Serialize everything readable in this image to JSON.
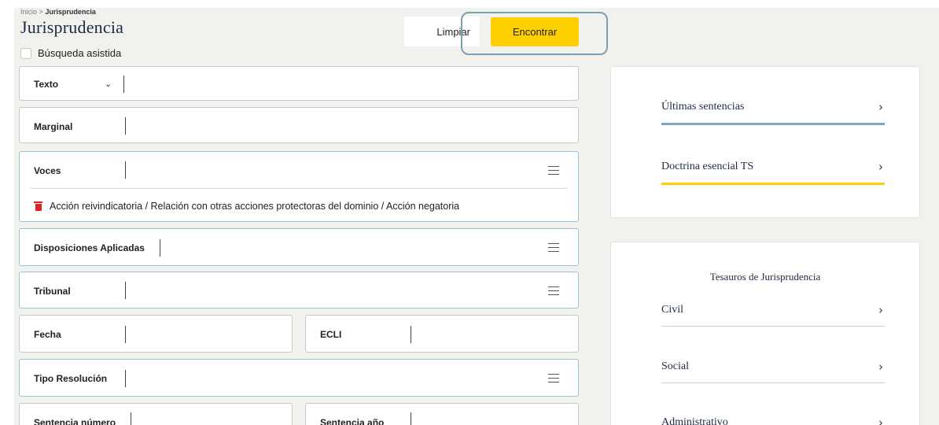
{
  "breadcrumb": {
    "home": "Inicio",
    "sep": ">",
    "current": "Jurisprudencia"
  },
  "page_title": "Jurisprudencia",
  "assisted_search_label": "Búsqueda asistida",
  "buttons": {
    "clear": "Limpiar",
    "find": "Encontrar"
  },
  "fields": {
    "texto": "Texto",
    "marginal": "Marginal",
    "voces": "Voces",
    "voces_tag": "Acción reivindicatoria / Relación con otras acciones protectoras del dominio / Acción negatoria",
    "disposiciones": "Disposiciones Aplicadas",
    "tribunal": "Tribunal",
    "fecha": "Fecha",
    "ecli": "ECLI",
    "tipo_resolucion": "Tipo Resolución",
    "sentencia_numero": "Sentencia número",
    "sentencia_anio": "Sentencia año"
  },
  "right": {
    "ultimas": "Últimas sentencias",
    "doctrina": "Doctrina esencial TS",
    "tesauros_title": "Tesauros de Jurisprudencia",
    "civil": "Civil",
    "social": "Social",
    "administrativo": "Administrativo",
    "arrow": "›"
  },
  "colors": {
    "accent_yellow": "#ffd000",
    "focus_blue": "#7d9fb5",
    "delete_red": "#e02020",
    "underline_blue": "#7fa6c0"
  }
}
